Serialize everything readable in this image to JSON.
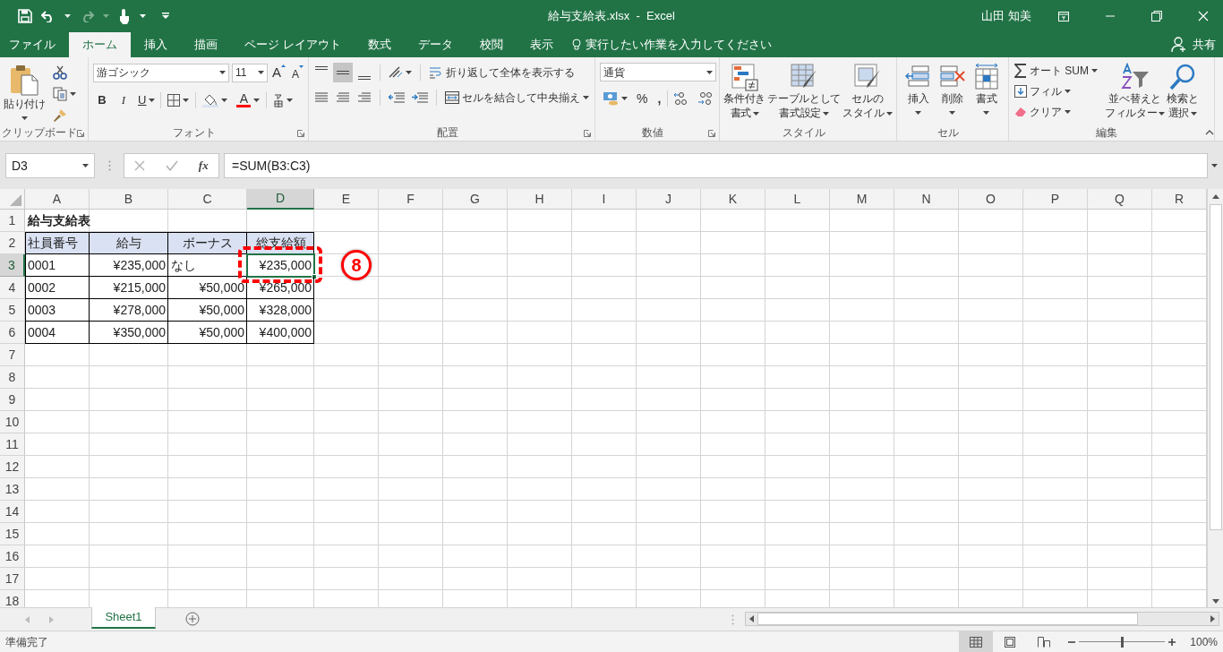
{
  "title_bar": {
    "title": "給与支給表.xlsx  -  Excel",
    "user": "山田 知美"
  },
  "ribbon_tabs": [
    {
      "label": "ファイル",
      "selected": false
    },
    {
      "label": "ホーム",
      "selected": true
    },
    {
      "label": "挿入",
      "selected": false
    },
    {
      "label": "描画",
      "selected": false
    },
    {
      "label": "ページ レイアウト",
      "selected": false
    },
    {
      "label": "数式",
      "selected": false
    },
    {
      "label": "データ",
      "selected": false
    },
    {
      "label": "校閲",
      "selected": false
    },
    {
      "label": "表示",
      "selected": false
    }
  ],
  "tell_me": "実行したい作業を入力してください",
  "share": "共有",
  "ribbon_groups": [
    {
      "kind": "clipboard",
      "label": "クリップボード",
      "paste": "貼り付け"
    },
    {
      "kind": "font",
      "label": "フォント",
      "font_name": "游ゴシック",
      "font_size": "11",
      "grow": "A",
      "shrink": "A",
      "bold": "B",
      "italic": "I",
      "underline": "U",
      "font_color": "A"
    },
    {
      "kind": "alignment",
      "label": "配置",
      "vertical": [
        {
          "selected": false
        },
        {
          "selected": true
        },
        {
          "selected": false
        }
      ],
      "wrap": "折り返して全体を表示する",
      "merge": "セルを結合して中央揃え"
    },
    {
      "kind": "number",
      "label": "数値",
      "format": "通貨",
      "percent": "%",
      "comma": ","
    },
    {
      "kind": "styles",
      "label": "スタイル",
      "buttons": [
        [
          "条件付き",
          "書式"
        ],
        [
          "テーブルとして",
          "書式設定"
        ],
        [
          "セルの",
          "スタイル"
        ]
      ]
    },
    {
      "kind": "cells",
      "label": "セル",
      "buttons": [
        "挿入",
        "削除",
        "書式"
      ]
    },
    {
      "kind": "editing",
      "label": "編集",
      "autosum": "オート SUM",
      "fill": "フィル",
      "clear": "クリア",
      "sort": [
        "並べ替えと",
        "フィルター"
      ],
      "find": [
        "検索と",
        "選択"
      ]
    }
  ],
  "formula_bar": {
    "name_box": "D3",
    "fx": "fx",
    "formula": "=SUM(B3:C3)"
  },
  "columns": [
    {
      "label": "A",
      "selected": false
    },
    {
      "label": "B",
      "selected": false
    },
    {
      "label": "C",
      "selected": false
    },
    {
      "label": "D",
      "selected": true
    },
    {
      "label": "E",
      "selected": false
    },
    {
      "label": "F",
      "selected": false
    },
    {
      "label": "G",
      "selected": false
    },
    {
      "label": "H",
      "selected": false
    },
    {
      "label": "I",
      "selected": false
    },
    {
      "label": "J",
      "selected": false
    },
    {
      "label": "K",
      "selected": false
    },
    {
      "label": "L",
      "selected": false
    },
    {
      "label": "M",
      "selected": false
    },
    {
      "label": "N",
      "selected": false
    },
    {
      "label": "O",
      "selected": false
    },
    {
      "label": "P",
      "selected": false
    },
    {
      "label": "Q",
      "selected": false
    },
    {
      "label": "R",
      "selected": false
    }
  ],
  "rows": [
    {
      "number": "1",
      "selected": false,
      "cells": [
        {
          "kind": "title",
          "text": "給与支給表",
          "border": false
        }
      ]
    },
    {
      "number": "2",
      "selected": false,
      "cells": [
        {
          "kind": "label",
          "text": "社員番号",
          "border": true,
          "shaded": true
        },
        {
          "kind": "heading",
          "text": "給与",
          "border": true,
          "shaded": true
        },
        {
          "kind": "heading",
          "text": "ボーナス",
          "border": true,
          "shaded": true
        },
        {
          "kind": "heading",
          "text": "総支給額",
          "border": true,
          "shaded": true
        }
      ]
    },
    {
      "number": "3",
      "selected": true,
      "cells": [
        {
          "kind": "label",
          "text": "0001",
          "border": true
        },
        {
          "kind": "number",
          "text": "¥235,000",
          "border": true
        },
        {
          "kind": "label",
          "text": "なし",
          "border": true
        },
        {
          "kind": "number",
          "text": "¥235,000",
          "border": true,
          "active": true
        }
      ]
    },
    {
      "number": "4",
      "selected": false,
      "cells": [
        {
          "kind": "label",
          "text": "0002",
          "border": true
        },
        {
          "kind": "number",
          "text": "¥215,000",
          "border": true
        },
        {
          "kind": "number",
          "text": "¥50,000",
          "border": true
        },
        {
          "kind": "number",
          "text": "¥265,000",
          "border": true
        }
      ]
    },
    {
      "number": "5",
      "selected": false,
      "cells": [
        {
          "kind": "label",
          "text": "0003",
          "border": true
        },
        {
          "kind": "number",
          "text": "¥278,000",
          "border": true
        },
        {
          "kind": "number",
          "text": "¥50,000",
          "border": true
        },
        {
          "kind": "number",
          "text": "¥328,000",
          "border": true
        }
      ]
    },
    {
      "number": "6",
      "selected": false,
      "cells": [
        {
          "kind": "label",
          "text": "0004",
          "border": true
        },
        {
          "kind": "number",
          "text": "¥350,000",
          "border": true
        },
        {
          "kind": "number",
          "text": "¥50,000",
          "border": true
        },
        {
          "kind": "number",
          "text": "¥400,000",
          "border": true
        }
      ]
    },
    {
      "number": "7",
      "selected": false
    },
    {
      "number": "8",
      "selected": false
    },
    {
      "number": "9",
      "selected": false
    },
    {
      "number": "10",
      "selected": false
    },
    {
      "number": "11",
      "selected": false
    },
    {
      "number": "12",
      "selected": false
    },
    {
      "number": "13",
      "selected": false
    },
    {
      "number": "14",
      "selected": false
    },
    {
      "number": "15",
      "selected": false
    },
    {
      "number": "16",
      "selected": false
    },
    {
      "number": "17",
      "selected": false
    },
    {
      "number": "18",
      "selected": false
    }
  ],
  "annotation": {
    "number": "8"
  },
  "sheet_tabs": [
    {
      "label": "Sheet1",
      "selected": true
    }
  ],
  "status_bar": {
    "status": "準備完了",
    "views": [
      {
        "kind": "normal",
        "selected": true
      },
      {
        "kind": "page_layout",
        "selected": false
      },
      {
        "kind": "page_break",
        "selected": false
      }
    ],
    "zoom_slider": {
      "level": 0.5
    },
    "zoom": "100%"
  }
}
